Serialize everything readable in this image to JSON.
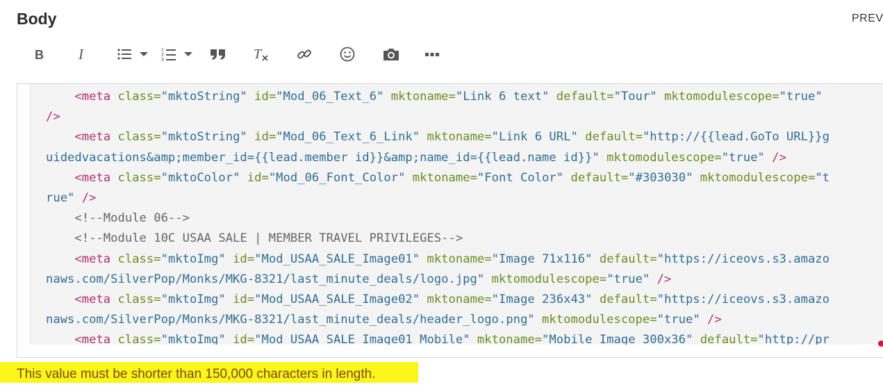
{
  "header": {
    "title": "Body",
    "preview_label": "PREVI"
  },
  "toolbar": {
    "buttons": [
      {
        "name": "bold",
        "icon": "bold-icon"
      },
      {
        "name": "italic",
        "icon": "italic-icon"
      },
      {
        "name": "bulleted-list",
        "icon": "bulleted-list-icon"
      },
      {
        "name": "numbered-list",
        "icon": "numbered-list-icon"
      },
      {
        "name": "blockquote",
        "icon": "quote-icon"
      },
      {
        "name": "remove-format",
        "icon": "clear-format-icon"
      },
      {
        "name": "link",
        "icon": "link-icon"
      },
      {
        "name": "emoji",
        "icon": "smiley-icon"
      },
      {
        "name": "image",
        "icon": "camera-icon"
      },
      {
        "name": "more",
        "icon": "more-icon"
      }
    ]
  },
  "editor": {
    "lines": [
      [
        {
          "t": "    ",
          "c": ""
        },
        {
          "t": "<meta ",
          "c": "tag"
        },
        {
          "t": "class=",
          "c": "attr"
        },
        {
          "t": "\"mktoString\" ",
          "c": "str"
        },
        {
          "t": "id=",
          "c": "attr"
        },
        {
          "t": "\"Mod_06_Text_6\" ",
          "c": "str"
        },
        {
          "t": "mktoname=",
          "c": "attr"
        },
        {
          "t": "\"Link 6 text\" ",
          "c": "str"
        },
        {
          "t": "default=",
          "c": "attr"
        },
        {
          "t": "\"Tour\" ",
          "c": "str"
        },
        {
          "t": "mktomodulescope=",
          "c": "attr"
        },
        {
          "t": "\"true\"",
          "c": "str"
        }
      ],
      [
        {
          "t": "/>",
          "c": "tag"
        }
      ],
      [
        {
          "t": "    ",
          "c": ""
        },
        {
          "t": "<meta ",
          "c": "tag"
        },
        {
          "t": "class=",
          "c": "attr"
        },
        {
          "t": "\"mktoString\" ",
          "c": "str"
        },
        {
          "t": "id=",
          "c": "attr"
        },
        {
          "t": "\"Mod_06_Text_6_Link\" ",
          "c": "str"
        },
        {
          "t": "mktoname=",
          "c": "attr"
        },
        {
          "t": "\"Link 6 URL\" ",
          "c": "str"
        },
        {
          "t": "default=",
          "c": "attr"
        },
        {
          "t": "\"http://{{lead.GoTo URL}}g",
          "c": "str"
        }
      ],
      [
        {
          "t": "uidedvacations&amp;member_id={{lead.member id}}&amp;name_id={{lead.name id}}\" ",
          "c": "str"
        },
        {
          "t": "mktomodulescope=",
          "c": "attr"
        },
        {
          "t": "\"true\" ",
          "c": "str"
        },
        {
          "t": "/>",
          "c": "tag"
        }
      ],
      [
        {
          "t": "    ",
          "c": ""
        },
        {
          "t": "<meta ",
          "c": "tag"
        },
        {
          "t": "class=",
          "c": "attr"
        },
        {
          "t": "\"mktoColor\" ",
          "c": "str"
        },
        {
          "t": "id=",
          "c": "attr"
        },
        {
          "t": "\"Mod_06_Font_Color\" ",
          "c": "str"
        },
        {
          "t": "mktoname=",
          "c": "attr"
        },
        {
          "t": "\"Font Color\" ",
          "c": "str"
        },
        {
          "t": "default=",
          "c": "attr"
        },
        {
          "t": "\"#303030\" ",
          "c": "str"
        },
        {
          "t": "mktomodulescope=",
          "c": "attr"
        },
        {
          "t": "\"t",
          "c": "str"
        }
      ],
      [
        {
          "t": "rue\" ",
          "c": "str"
        },
        {
          "t": "/>",
          "c": "tag"
        }
      ],
      [
        {
          "t": "    ",
          "c": ""
        },
        {
          "t": "<!--Module 06-->",
          "c": "cmt"
        }
      ],
      [
        {
          "t": "    ",
          "c": ""
        },
        {
          "t": "<!--Module 10C USAA SALE | MEMBER TRAVEL PRIVILEGES-->",
          "c": "cmt"
        }
      ],
      [
        {
          "t": "    ",
          "c": ""
        },
        {
          "t": "<meta ",
          "c": "tag"
        },
        {
          "t": "class=",
          "c": "attr"
        },
        {
          "t": "\"mktoImg\" ",
          "c": "str"
        },
        {
          "t": "id=",
          "c": "attr"
        },
        {
          "t": "\"Mod_USAA_SALE_Image01\" ",
          "c": "str"
        },
        {
          "t": "mktoname=",
          "c": "attr"
        },
        {
          "t": "\"Image 71x116\" ",
          "c": "str"
        },
        {
          "t": "default=",
          "c": "attr"
        },
        {
          "t": "\"https://iceovs.s3.amazo",
          "c": "str"
        }
      ],
      [
        {
          "t": "naws.com/SilverPop/Monks/MKG-8321/last_minute_deals/logo.jpg\" ",
          "c": "str"
        },
        {
          "t": "mktomodulescope=",
          "c": "attr"
        },
        {
          "t": "\"true\" ",
          "c": "str"
        },
        {
          "t": "/>",
          "c": "tag"
        }
      ],
      [
        {
          "t": "    ",
          "c": ""
        },
        {
          "t": "<meta ",
          "c": "tag"
        },
        {
          "t": "class=",
          "c": "attr"
        },
        {
          "t": "\"mktoImg\" ",
          "c": "str"
        },
        {
          "t": "id=",
          "c": "attr"
        },
        {
          "t": "\"Mod_USAA_SALE_Image02\" ",
          "c": "str"
        },
        {
          "t": "mktoname=",
          "c": "attr"
        },
        {
          "t": "\"Image 236x43\" ",
          "c": "str"
        },
        {
          "t": "default=",
          "c": "attr"
        },
        {
          "t": "\"https://iceovs.s3.amazo",
          "c": "str"
        }
      ],
      [
        {
          "t": "naws.com/SilverPop/Monks/MKG-8321/last_minute_deals/header_logo.png\" ",
          "c": "str"
        },
        {
          "t": "mktomodulescope=",
          "c": "attr"
        },
        {
          "t": "\"true\" ",
          "c": "str"
        },
        {
          "t": "/>",
          "c": "tag"
        }
      ],
      [
        {
          "t": "    ",
          "c": ""
        },
        {
          "t": "<meta ",
          "c": "tag"
        },
        {
          "t": "class=",
          "c": "attr"
        },
        {
          "t": "\"mktoImg\" ",
          "c": "str"
        },
        {
          "t": "id=",
          "c": "attr"
        },
        {
          "t": "\"Mod_USAA_SALE_Image01_Mobile\" ",
          "c": "str"
        },
        {
          "t": "mktoname=",
          "c": "attr"
        },
        {
          "t": "\"Mobile Image 300x36\" ",
          "c": "str"
        },
        {
          "t": "default=",
          "c": "attr"
        },
        {
          "t": "\"http://pr",
          "c": "str"
        }
      ]
    ]
  },
  "validation": {
    "message": "This value must be shorter than 150,000 characters in length."
  },
  "colors": {
    "highlight": "#fbf51b",
    "tag": "#b1316b",
    "attribute": "#6a8c1f",
    "string": "#2f6d94"
  }
}
